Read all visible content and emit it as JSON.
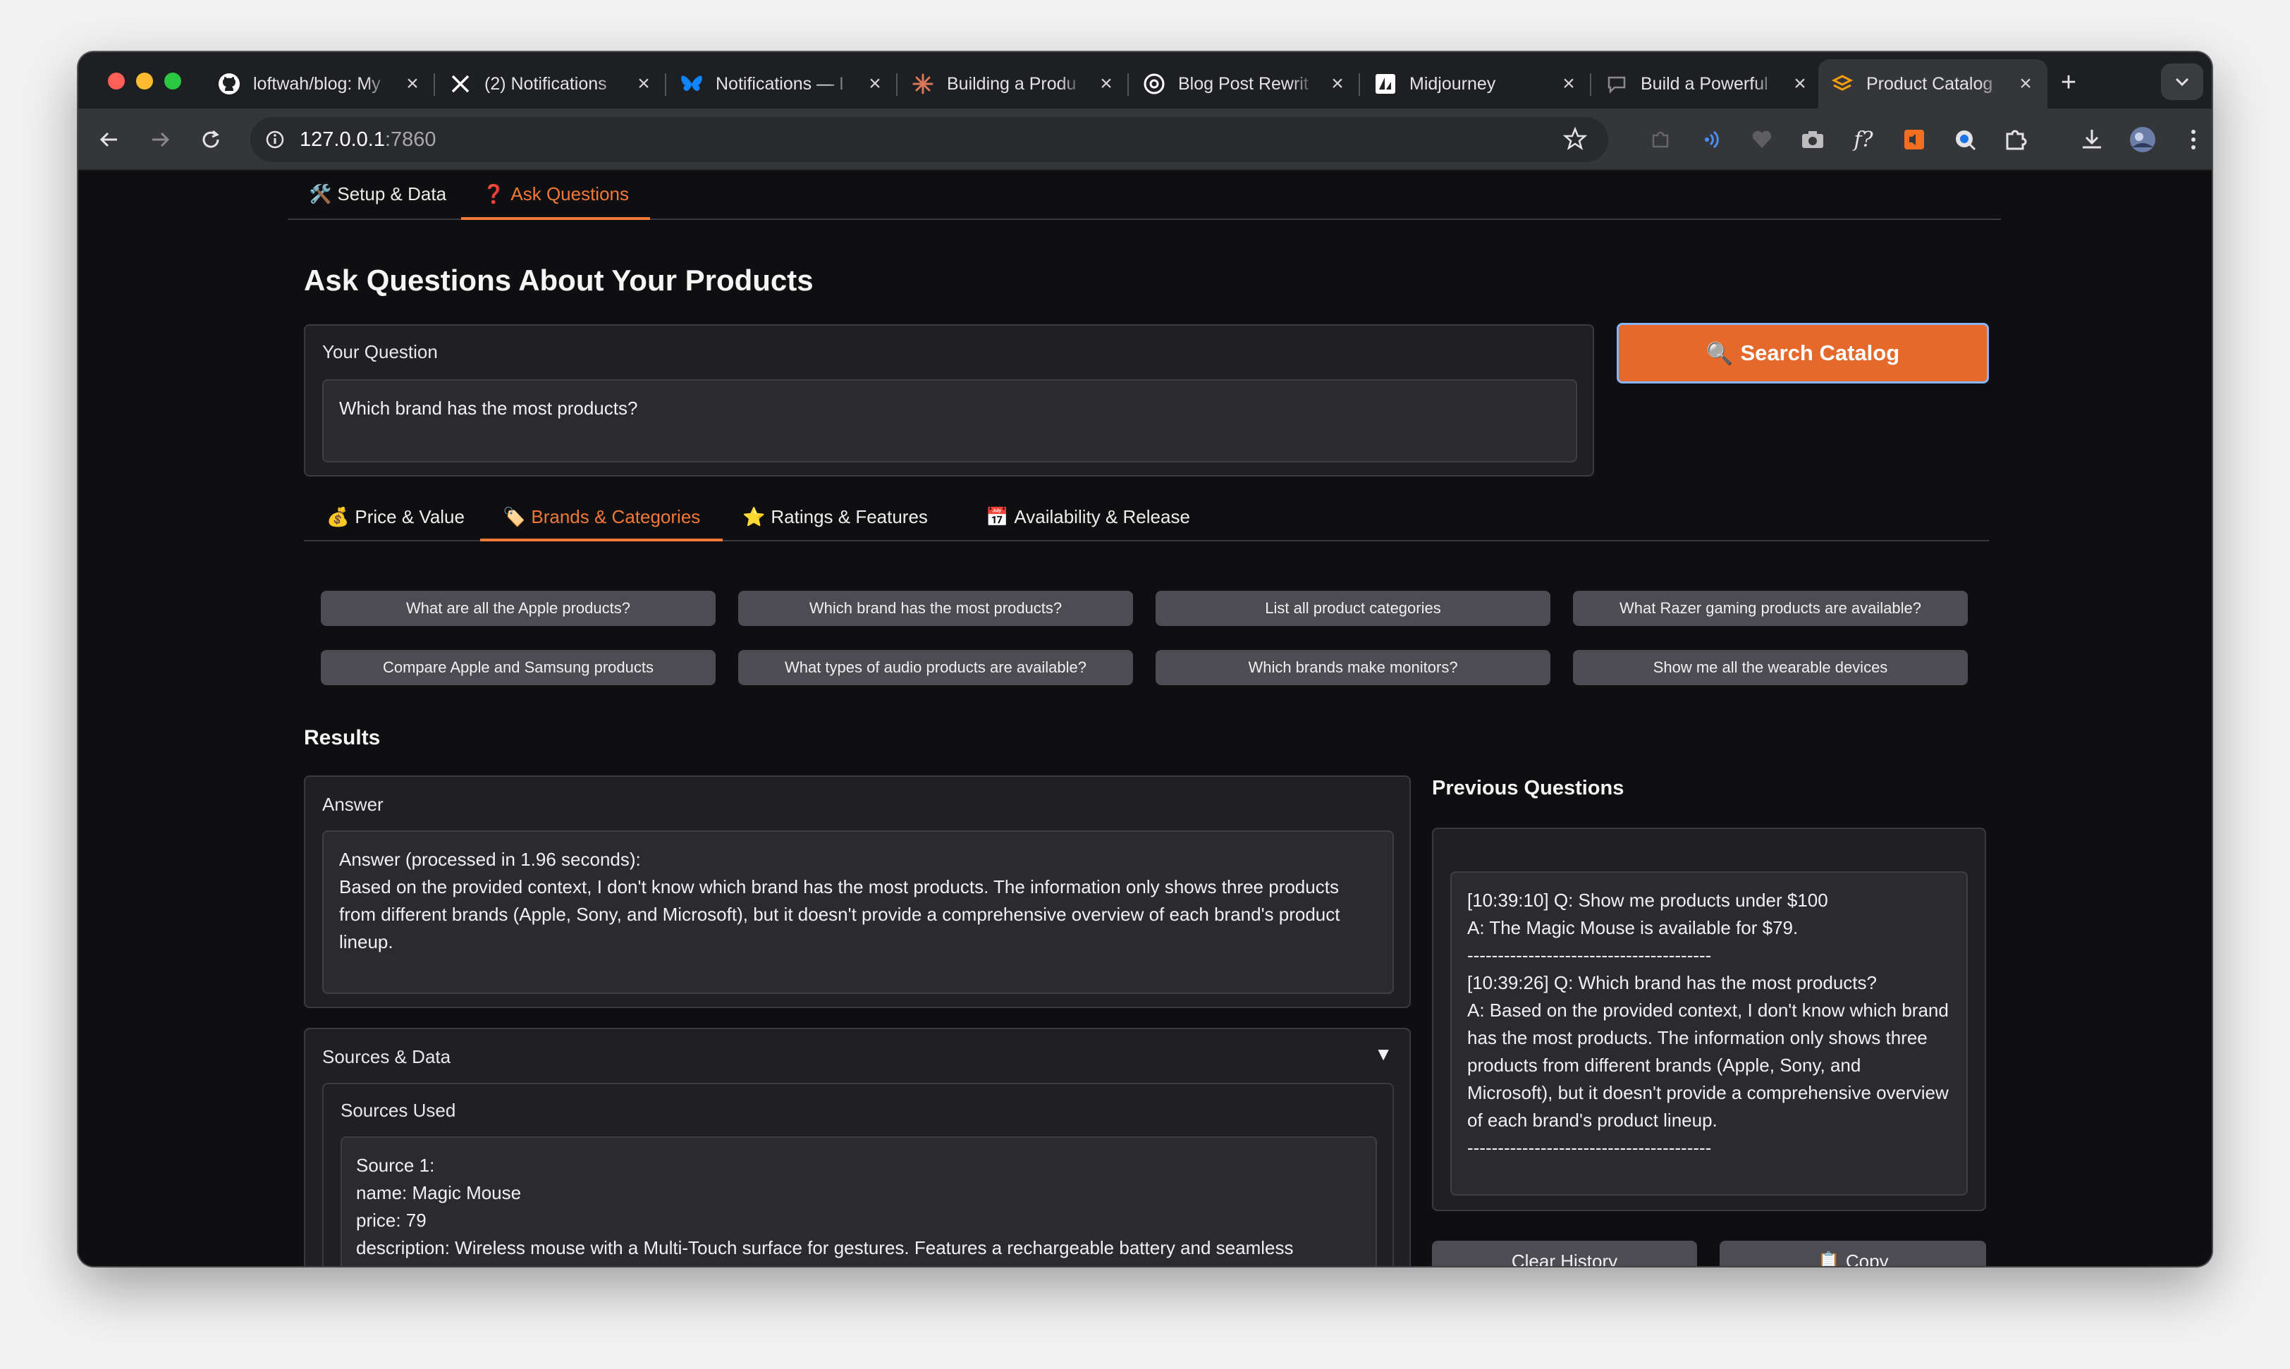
{
  "browser": {
    "tabs": [
      {
        "title": "loftwah/blog: My",
        "icon": "github-icon"
      },
      {
        "title": "(2) Notifications",
        "icon": "x-icon"
      },
      {
        "title": "Notifications — I",
        "icon": "bluesky-icon"
      },
      {
        "title": "Building a Produ",
        "icon": "claude-icon"
      },
      {
        "title": "Blog Post Rewrit",
        "icon": "openai-icon"
      },
      {
        "title": "Midjourney",
        "icon": "midjourney-icon"
      },
      {
        "title": "Build a Powerful",
        "icon": "chat-icon"
      },
      {
        "title": "Product Catalog",
        "icon": "gradio-icon"
      }
    ],
    "url_host": "127.0.0.1",
    "url_port": ":7860"
  },
  "app": {
    "main_tabs": [
      {
        "icon": "🛠️",
        "label": "Setup & Data"
      },
      {
        "icon": "❓",
        "label": "Ask Questions"
      }
    ],
    "heading": "Ask Questions About Your Products",
    "question_label": "Your Question",
    "question_value": "Which brand has the most products?",
    "search_button": "Search Catalog",
    "search_icon": "🔍",
    "example_tabs": [
      {
        "icon": "💰",
        "label": "Price & Value"
      },
      {
        "icon": "🏷️",
        "label": "Brands & Categories"
      },
      {
        "icon": "⭐",
        "label": "Ratings & Features"
      },
      {
        "icon": "📅",
        "label": "Availability & Release"
      }
    ],
    "example_questions": [
      "What are all the Apple products?",
      "Which brand has the most products?",
      "List all product categories",
      "What Razer gaming products are available?",
      "Compare Apple and Samsung products",
      "What types of audio products are available?",
      "Which brands make monitors?",
      "Show me all the wearable devices"
    ],
    "results_title": "Results",
    "answer_label": "Answer",
    "answer_line1": "Answer (processed in 1.96 seconds):",
    "answer_body": "Based on the provided context, I don't know which brand has the most products. The information only shows three products from different brands (Apple, Sony, and Microsoft), but it doesn't provide a comprehensive overview of each brand's product lineup.",
    "sources_label": "Sources & Data",
    "sources_used_label": "Sources Used",
    "sources_lines": [
      "Source 1:",
      "name: Magic Mouse",
      "price: 79",
      "description: Wireless mouse with a Multi-Touch surface for gestures. Features a rechargeable battery and seamless"
    ],
    "previous_title": "Previous Questions",
    "history": [
      "[10:39:10] Q: Show me products under $100",
      "A: The Magic Mouse is available for $79.",
      "----------------------------------------",
      "[10:39:26] Q: Which brand has the most products?",
      "A: Based on the provided context, I don't know which brand has the most products. The information only shows three products from different brands (Apple, Sony, and Microsoft), but it doesn't provide a comprehensive overview of each brand's product lineup.",
      "----------------------------------------"
    ],
    "clear_history_label": "Clear History",
    "copy_label": "Copy",
    "copy_icon": "📋",
    "accent_color": "#e4692b"
  }
}
